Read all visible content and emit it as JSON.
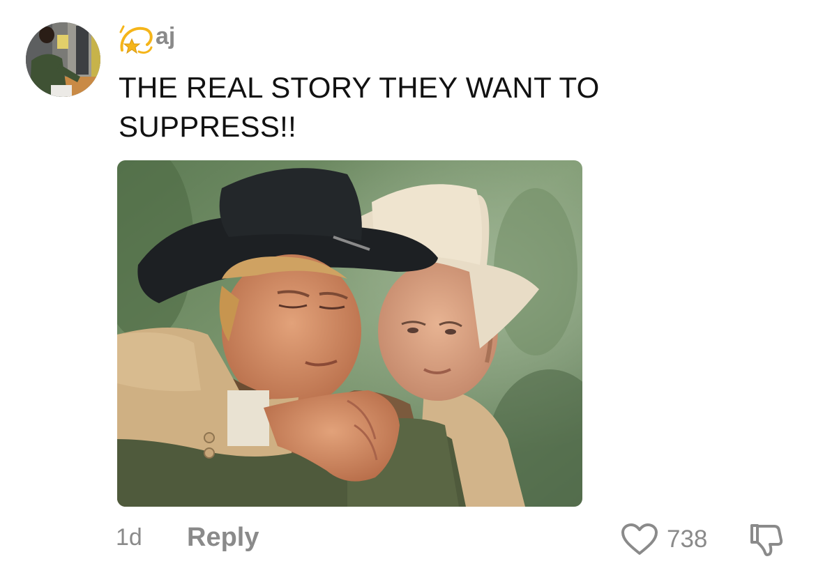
{
  "comment": {
    "username": "aj",
    "username_icon": "dizzy-star-icon",
    "text": "THE REAL STORY THEY WANT TO SUPPRESS!!",
    "timestamp": "1d",
    "reply_label": "Reply",
    "like_count": "738",
    "like_icon": "heart-outline-icon",
    "dislike_icon": "thumbs-down-outline-icon"
  },
  "colors": {
    "secondary_text": "#8a8a8a",
    "primary_text": "#111111",
    "icon_gold": "#f5b51a"
  }
}
